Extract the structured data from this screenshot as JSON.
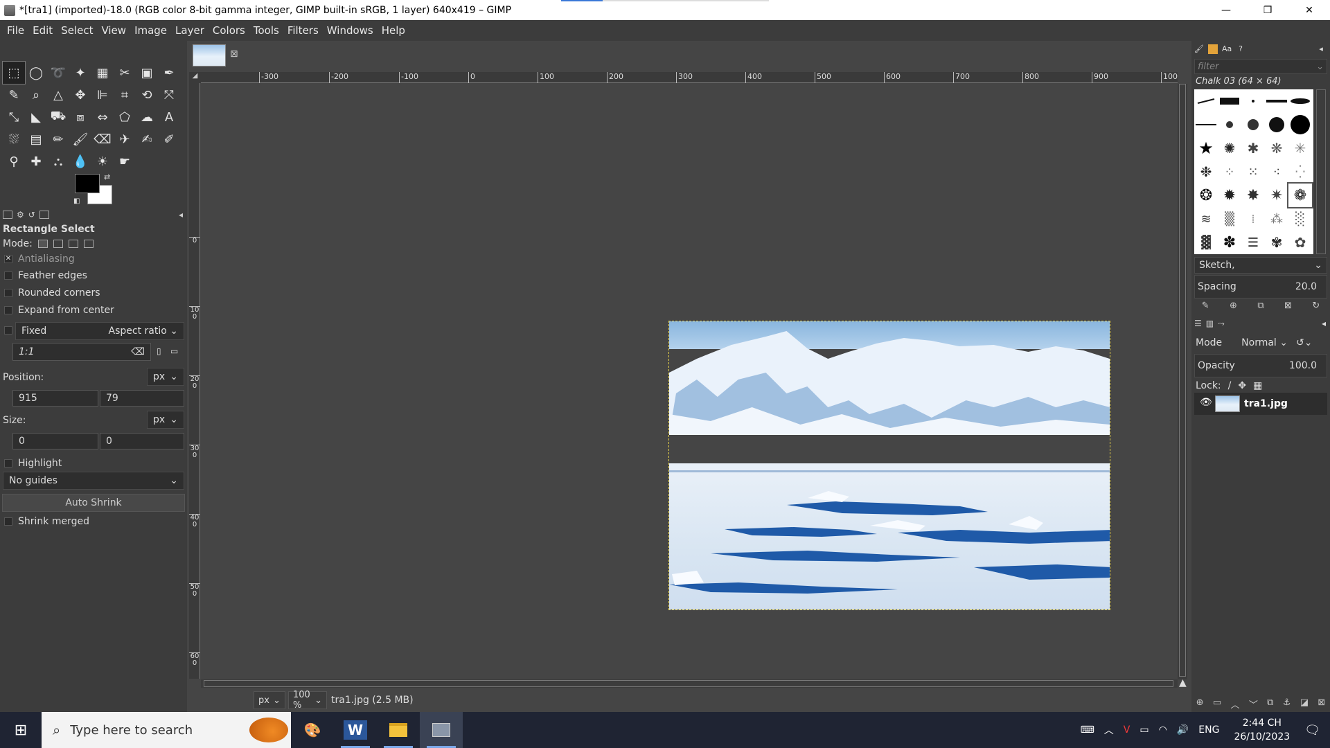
{
  "window": {
    "title": "*[tra1] (imported)-18.0 (RGB color 8-bit gamma integer, GIMP built-in sRGB, 1 layer) 640x419 – GIMP",
    "min": "—",
    "max": "❐",
    "close": "✕"
  },
  "menu": [
    "File",
    "Edit",
    "Select",
    "View",
    "Image",
    "Layer",
    "Colors",
    "Tools",
    "Filters",
    "Windows",
    "Help"
  ],
  "tool_options": {
    "title": "Rectangle Select",
    "mode_label": "Mode:",
    "antialiasing": "Antialiasing",
    "feather": "Feather edges",
    "rounded": "Rounded corners",
    "expand": "Expand from center",
    "fixed": "Fixed",
    "fixed_option": "Aspect ratio",
    "ratio": "1:1",
    "position_label": "Position:",
    "position_unit": "px",
    "pos_x": "915",
    "pos_y": "79",
    "size_label": "Size:",
    "size_unit": "px",
    "size_w": "0",
    "size_h": "0",
    "highlight": "Highlight",
    "guides": "No guides",
    "auto_shrink": "Auto Shrink",
    "shrink_merged": "Shrink merged"
  },
  "ruler": {
    "h": [
      "-300",
      "-200",
      "-100",
      "0",
      "100",
      "200",
      "300",
      "400",
      "500",
      "600",
      "700",
      "800",
      "900",
      "100"
    ],
    "v": [
      "0",
      "100",
      "200",
      "300",
      "400",
      "500",
      "600"
    ]
  },
  "status": {
    "unit": "px",
    "zoom": "100 %",
    "file": "tra1.jpg (2.5 MB)"
  },
  "brushes": {
    "filter_placeholder": "filter",
    "name": "Chalk 03 (64 × 64)",
    "preset": "Sketch,",
    "spacing_label": "Spacing",
    "spacing_value": "20.0"
  },
  "layers": {
    "mode_label": "Mode",
    "mode_value": "Normal",
    "opacity_label": "Opacity",
    "opacity_value": "100.0",
    "lock_label": "Lock:",
    "layer_name": "tra1.jpg"
  },
  "taskbar": {
    "search_placeholder": "Type here to search",
    "lang": "ENG",
    "time": "2:44 CH",
    "date": "26/10/2023"
  },
  "colors": {
    "fg": "#000000",
    "bg": "#ffffff",
    "accent": "#3b78d8"
  }
}
